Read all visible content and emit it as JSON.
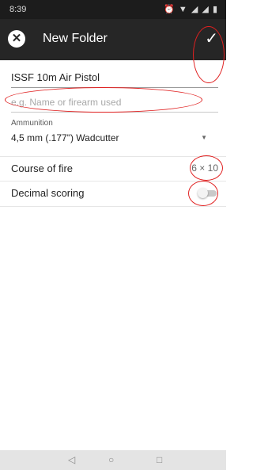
{
  "status_bar": {
    "time": "8:39",
    "icons": [
      "alarm-icon",
      "wifi-icon",
      "signal-icon",
      "signal-icon",
      "battery-icon"
    ]
  },
  "toolbar": {
    "close_icon": "close-circle-icon",
    "title": "New Folder",
    "confirm_icon": "check-icon"
  },
  "form": {
    "name_value": "ISSF 10m Air Pistol",
    "description_placeholder": "e.g. Name or firearm used",
    "ammunition_label": "Ammunition",
    "ammunition_value": "4,5 mm (.177\") Wadcutter",
    "course_of_fire_label": "Course of fire",
    "course_of_fire_value": "6 × 10",
    "decimal_scoring_label": "Decimal scoring",
    "decimal_scoring_on": false
  },
  "nav_bar": {
    "back_icon": "triangle-back-icon",
    "home_icon": "circle-home-icon",
    "recent_icon": "square-recents-icon"
  },
  "colors": {
    "toolbar": "#262626",
    "status_bar": "#1c1c1c",
    "annotation": "#e02020"
  }
}
